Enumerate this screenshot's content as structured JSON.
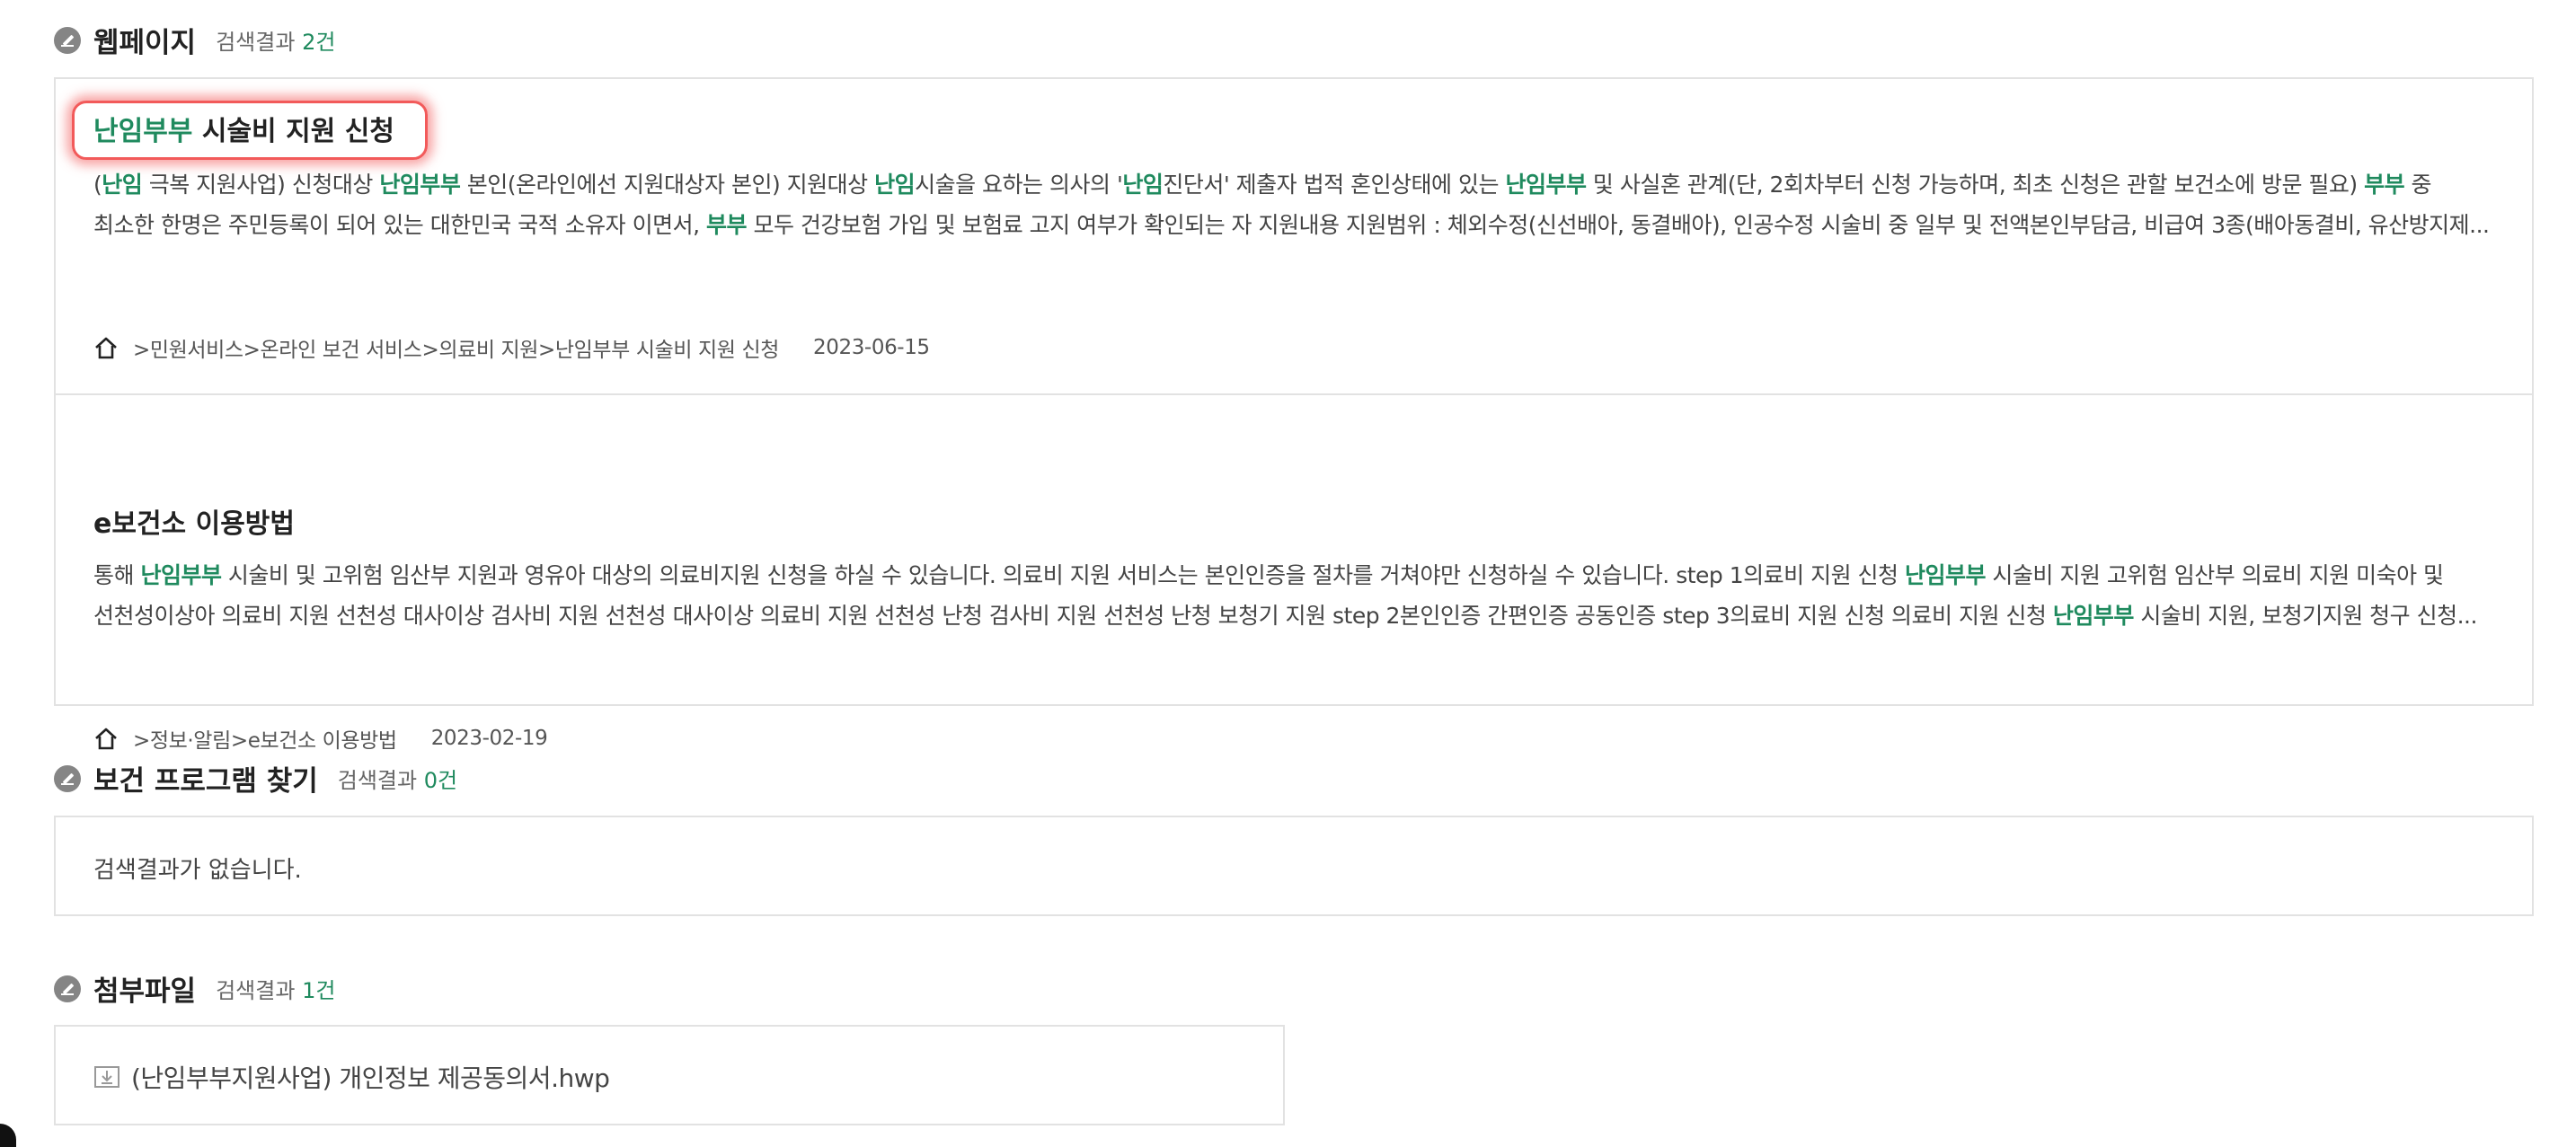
{
  "sections": {
    "webpage": {
      "title": "웹페이지",
      "count_prefix": "검색결과",
      "count": "2건"
    },
    "program": {
      "title": "보건 프로그램 찾기",
      "count_prefix": "검색결과",
      "count": "0건"
    },
    "attachment": {
      "title": "첨부파일",
      "count_prefix": "검색결과",
      "count": "1건"
    }
  },
  "results": [
    {
      "title_highlight": "난임부부",
      "title_rest": " 시술비 지원 신청",
      "snippet": [
        {
          "text": "(",
          "hl": false
        },
        {
          "text": "난임",
          "hl": true
        },
        {
          "text": " 극복 지원사업) 신청대상 ",
          "hl": false
        },
        {
          "text": "난임부부",
          "hl": true
        },
        {
          "text": " 본인(온라인에선 지원대상자 본인) 지원대상 ",
          "hl": false
        },
        {
          "text": "난임",
          "hl": true
        },
        {
          "text": "시술을 요하는 의사의 '",
          "hl": false
        },
        {
          "text": "난임",
          "hl": true
        },
        {
          "text": "진단서' 제출자 법적 혼인상태에 있는 ",
          "hl": false
        },
        {
          "text": "난임부부",
          "hl": true
        },
        {
          "text": " 및 사실혼 관계(단, 2회차부터 신청 가능하며, 최초 신청은 관할 보건소에 방문 필요) ",
          "hl": false
        },
        {
          "text": "부부",
          "hl": true
        },
        {
          "text": " 중 최소한 한명은 주민등록이 되어 있는 대한민국 국적 소유자 이면서, ",
          "hl": false
        },
        {
          "text": "부부",
          "hl": true
        },
        {
          "text": " 모두 건강보험 가입 및 보험료 고지 여부가 확인되는 자 지원내용 지원범위 : 체외수정(신선배아, 동결배아), 인공수정 시술비 중 일부 및 전액본인부담금, 비급여 3종(배아동결비, 유산방지제...",
          "hl": false
        }
      ],
      "breadcrumb": ">민원서비스>온라인 보건 서비스>의료비 지원>난임부부 시술비 지원 신청",
      "date": "2023-06-15"
    },
    {
      "title_highlight": "",
      "title_rest": "e보건소 이용방법",
      "snippet": [
        {
          "text": "통해 ",
          "hl": false
        },
        {
          "text": "난임부부",
          "hl": true
        },
        {
          "text": " 시술비 및 고위험 임산부 지원과 영유아 대상의 의료비지원 신청을 하실 수 있습니다. 의료비 지원 서비스는 본인인증을 절차를 거쳐야만 신청하실 수 있습니다. step 1의료비 지원 신청 ",
          "hl": false
        },
        {
          "text": "난임부부",
          "hl": true
        },
        {
          "text": " 시술비 지원 고위험 임산부 의료비 지원 미숙아 및 선천성이상아 의료비 지원 선천성 대사이상 검사비 지원 선천성 대사이상 의료비 지원 선천성 난청 검사비 지원 선천성 난청 보청기 지원 step 2본인인증 간편인증 공동인증 step 3의료비 지원 신청 의료비 지원 신청 ",
          "hl": false
        },
        {
          "text": "난임부부",
          "hl": true
        },
        {
          "text": " 시술비 지원, 보청기지원 청구 신청...",
          "hl": false
        }
      ],
      "breadcrumb": ">정보·알림>e보건소 이용방법",
      "date": "2023-02-19"
    }
  ],
  "program_empty_text": "검색결과가 없습니다.",
  "attachment_file": "(난임부부지원사업) 개인정보 제공동의서.hwp",
  "icons": {
    "section": "pen-circle-icon",
    "home": "home-icon",
    "file": "download-file-icon"
  },
  "colors": {
    "highlight": "#1f8a5e",
    "focus_ring": "#f25a5a",
    "border": "#e2e2e2"
  }
}
